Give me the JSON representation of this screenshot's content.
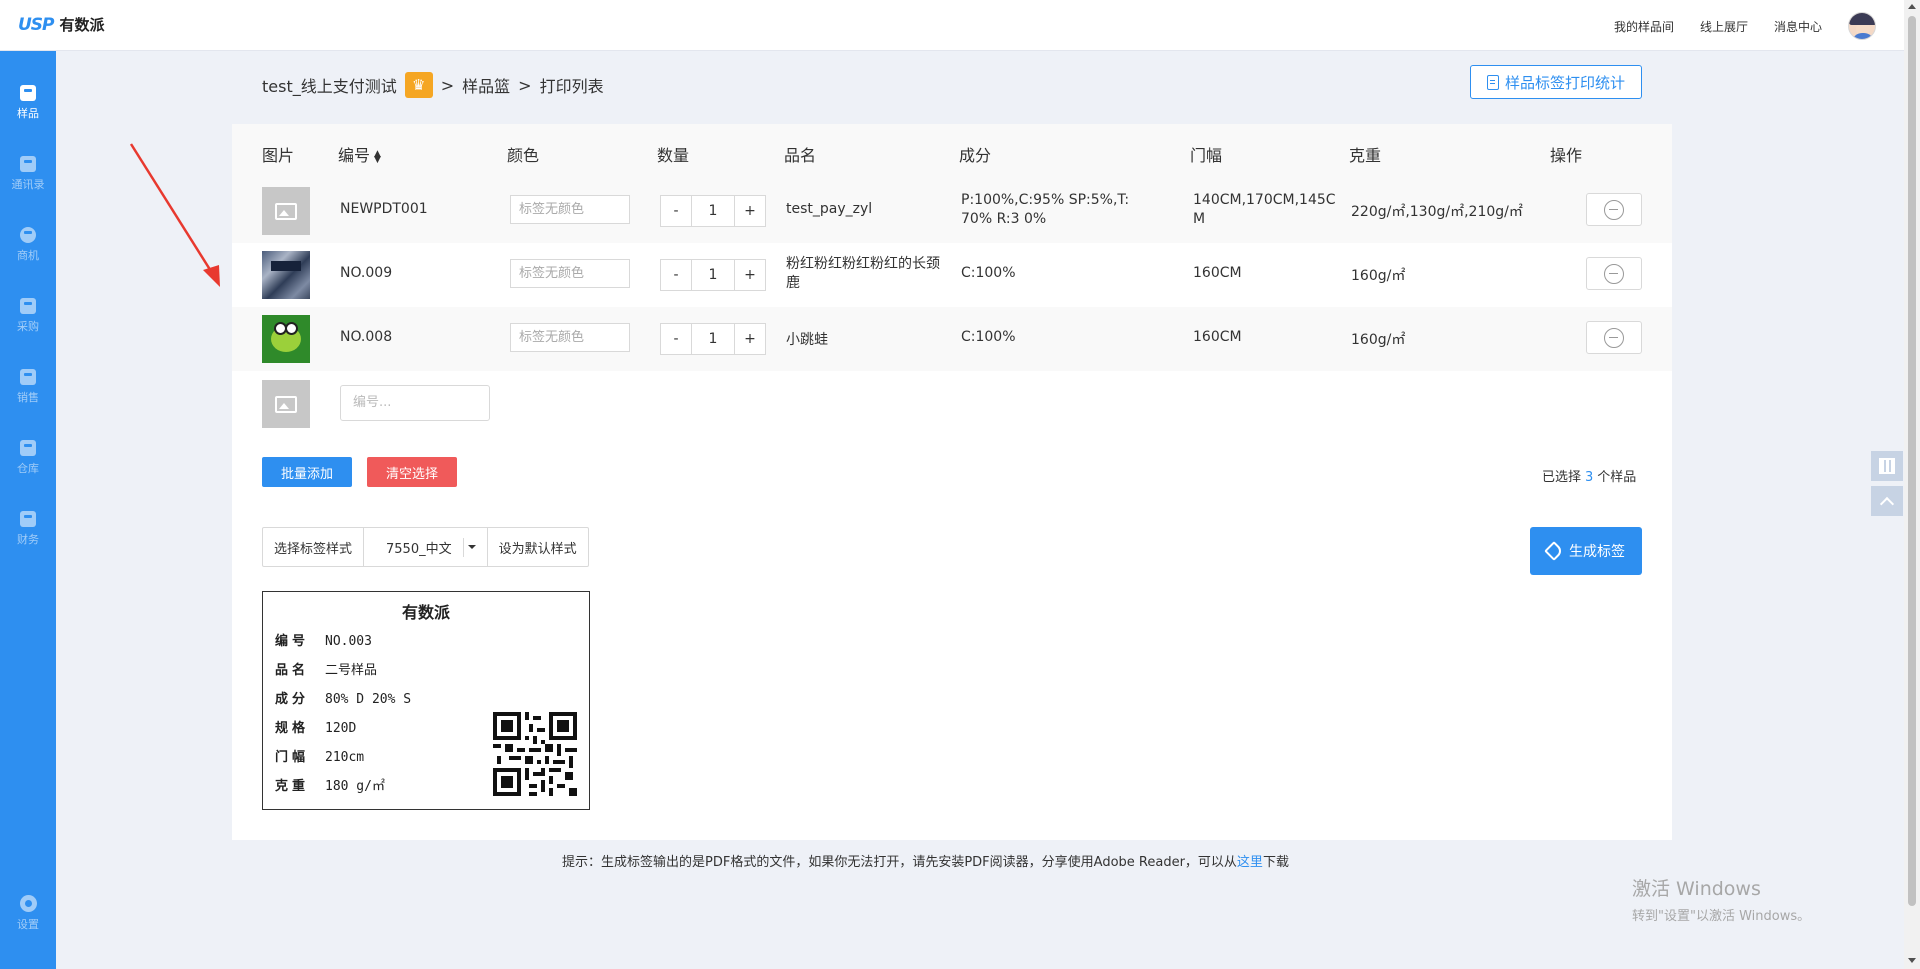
{
  "brand": {
    "mark": "USP",
    "name": "有数派"
  },
  "topnav": [
    "我的样品间",
    "线上展厅",
    "消息中心"
  ],
  "sidebar": {
    "items": [
      {
        "label": "样品",
        "icon": "sample-icon",
        "active": true
      },
      {
        "label": "通讯录",
        "icon": "contacts-icon"
      },
      {
        "label": "商机",
        "icon": "opportunity-icon"
      },
      {
        "label": "采购",
        "icon": "purchase-icon"
      },
      {
        "label": "销售",
        "icon": "sales-icon"
      },
      {
        "label": "仓库",
        "icon": "warehouse-icon"
      },
      {
        "label": "财务",
        "icon": "finance-icon"
      }
    ],
    "settings_label": "设置"
  },
  "breadcrumb": {
    "company": "test_线上支付测试",
    "sep": ">",
    "basket": "样品篮",
    "current": "打印列表"
  },
  "stat_button": "样品标签打印统计",
  "table": {
    "headers": {
      "image": "图片",
      "code": "编号",
      "color": "颜色",
      "qty": "数量",
      "name": "品名",
      "composition": "成分",
      "width": "门幅",
      "weight": "克重",
      "action": "操作"
    },
    "rows": [
      {
        "image": "placeholder",
        "code": "NEWPDT001",
        "color_placeholder": "标签无颜色",
        "minus": "-",
        "qty": "1",
        "plus": "+",
        "name": "test_pay_zyl",
        "composition": "P:100%,C:95% SP:5%,T: 70% R:3 0%",
        "width": "140CM,170CM,145C M",
        "weight": "220g/㎡,130g/㎡,210g/㎡"
      },
      {
        "image": "fabric",
        "code": "NO.009",
        "color_placeholder": "标签无颜色",
        "minus": "-",
        "qty": "1",
        "plus": "+",
        "name": "粉红粉红粉红粉红的长颈鹿",
        "composition": "C:100%",
        "width": "160CM",
        "weight": "160g/㎡"
      },
      {
        "image": "frog",
        "code": "NO.008",
        "color_placeholder": "标签无颜色",
        "minus": "-",
        "qty": "1",
        "plus": "+",
        "name": "小跳蛙",
        "composition": "C:100%",
        "width": "160CM",
        "weight": "160g/㎡"
      }
    ],
    "new_code_placeholder": "编号..."
  },
  "actions": {
    "batch_add": "批量添加",
    "clear": "清空选择",
    "selected_prefix": "已选择",
    "selected_count": "3",
    "selected_suffix": "个样品"
  },
  "label_style": {
    "choose": "选择标签样式",
    "selected": "7550_中文",
    "set_default": "设为默认样式",
    "generate": "生成标签"
  },
  "label_preview": {
    "title": "有数派",
    "fields": [
      {
        "k": "编号",
        "v": "NO.003"
      },
      {
        "k": "品名",
        "v": "二号样品"
      },
      {
        "k": "成分",
        "v": "80% D 20% S"
      },
      {
        "k": "规格",
        "v": "120D"
      },
      {
        "k": "门幅",
        "v": "210cm"
      },
      {
        "k": "克重",
        "v": "180 g/㎡"
      }
    ]
  },
  "tip": {
    "text": "提示：生成标签输出的是PDF格式的文件，如果你无法打开，请先安装PDF阅读器，分享使用Adobe Reader，可以从",
    "link": "这里",
    "after": "下载"
  },
  "watermark": {
    "line1": "激活 Windows",
    "line2": "转到\"设置\"以激活 Windows。"
  },
  "colors": {
    "primary": "#2e8ff0",
    "danger": "#f05a5a",
    "crown": "#f5a623",
    "annotation_arrow": "#e8392f"
  }
}
